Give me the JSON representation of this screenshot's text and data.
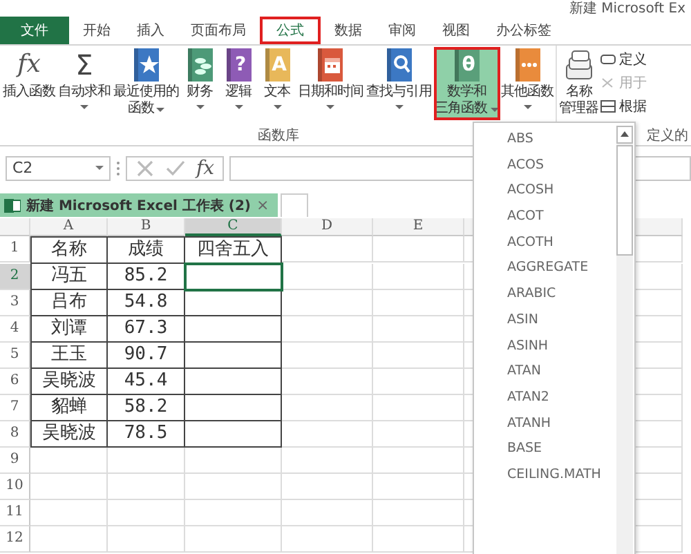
{
  "window": {
    "title": "新建 Microsoft Ex"
  },
  "tabs": [
    {
      "label": "文件",
      "kind": "file",
      "selected": false
    },
    {
      "label": "开始",
      "kind": "tab",
      "selected": false
    },
    {
      "label": "插入",
      "kind": "tab",
      "selected": false
    },
    {
      "label": "页面布局",
      "kind": "tab",
      "selected": false
    },
    {
      "label": "公式",
      "kind": "tab",
      "selected": true
    },
    {
      "label": "数据",
      "kind": "tab",
      "selected": false
    },
    {
      "label": "审阅",
      "kind": "tab",
      "selected": false
    },
    {
      "label": "视图",
      "kind": "tab",
      "selected": false
    },
    {
      "label": "办公标签",
      "kind": "tab",
      "selected": false
    }
  ],
  "ribbon": {
    "groups": [
      {
        "label": "函数库",
        "buttons": [
          {
            "lines": [
              "插入函数"
            ],
            "kind": "fx",
            "glyph": "fx",
            "dropdown": false,
            "selected": false
          },
          {
            "lines": [
              "自动求和"
            ],
            "kind": "sigma",
            "glyph": "Σ",
            "dropdown": true,
            "selected": false
          },
          {
            "lines": [
              "最近使用的",
              "函数"
            ],
            "kind": "recent",
            "dropdown": true,
            "selected": false
          },
          {
            "lines": [
              "财务"
            ],
            "kind": "finance",
            "dropdown": true,
            "selected": false
          },
          {
            "lines": [
              "逻辑"
            ],
            "kind": "logic",
            "glyph": "?",
            "dropdown": true,
            "selected": false
          },
          {
            "lines": [
              "文本"
            ],
            "kind": "text",
            "glyph": "A",
            "dropdown": true,
            "selected": false
          },
          {
            "lines": [
              "日期和时间"
            ],
            "kind": "date",
            "dropdown": true,
            "selected": false
          },
          {
            "lines": [
              "查找与引用"
            ],
            "kind": "lookup",
            "dropdown": true,
            "selected": false
          },
          {
            "lines": [
              "数学和",
              "三角函数"
            ],
            "kind": "math",
            "glyph": "θ",
            "dropdown": true,
            "selected": true
          },
          {
            "lines": [
              "其他函数"
            ],
            "kind": "other",
            "dropdown": true,
            "selected": false
          }
        ]
      },
      {
        "label": "定义的",
        "buttons": [
          {
            "lines": [
              "名称",
              "管理器"
            ],
            "kind": "names",
            "dropdown": false,
            "selected": false
          }
        ],
        "small_items": [
          {
            "label": "定义",
            "kind": "define",
            "disabled": false
          },
          {
            "label": "用于",
            "kind": "use",
            "disabled": true
          },
          {
            "label": "根据",
            "kind": "create",
            "disabled": false
          }
        ]
      }
    ]
  },
  "formula_bar": {
    "name_box": "C2",
    "cancel_enabled": false,
    "enter_enabled": false,
    "fx": "fx"
  },
  "workbook_tab": {
    "label": "新建 Microsoft Excel 工作表 (2)",
    "close": "×"
  },
  "sheet": {
    "columns": [
      {
        "label": "A",
        "selected": false
      },
      {
        "label": "B",
        "selected": false
      },
      {
        "label": "C",
        "selected": true
      },
      {
        "label": "D",
        "selected": false
      },
      {
        "label": "E",
        "selected": false
      }
    ],
    "rows": [
      {
        "number": "1",
        "selected": false,
        "bordered": true,
        "cells": {
          "A": "名称",
          "B": "成绩",
          "C": "四舍五入"
        }
      },
      {
        "number": "2",
        "selected": true,
        "bordered": true,
        "cells": {
          "A": "冯五",
          "B": "85.2"
        }
      },
      {
        "number": "3",
        "selected": false,
        "bordered": true,
        "cells": {
          "A": "吕布",
          "B": "54.8"
        }
      },
      {
        "number": "4",
        "selected": false,
        "bordered": true,
        "cells": {
          "A": "刘谭",
          "B": "67.3"
        }
      },
      {
        "number": "5",
        "selected": false,
        "bordered": true,
        "cells": {
          "A": "王玉",
          "B": "90.7"
        }
      },
      {
        "number": "6",
        "selected": false,
        "bordered": true,
        "cells": {
          "A": "吴晓波",
          "B": "45.4"
        }
      },
      {
        "number": "7",
        "selected": false,
        "bordered": true,
        "cells": {
          "A": "貂蝉",
          "B": "58.2"
        }
      },
      {
        "number": "8",
        "selected": false,
        "bordered": true,
        "cells": {
          "A": "吴晓波",
          "B": "78.5"
        }
      },
      {
        "number": "9",
        "selected": false,
        "bordered": false,
        "cells": {}
      },
      {
        "number": "10",
        "selected": false,
        "bordered": false,
        "cells": {}
      },
      {
        "number": "11",
        "selected": false,
        "bordered": false,
        "cells": {}
      },
      {
        "number": "12",
        "selected": false,
        "bordered": false,
        "cells": {}
      }
    ]
  },
  "function_menu": {
    "items": [
      "ABS",
      "ACOS",
      "ACOSH",
      "ACOT",
      "ACOTH",
      "AGGREGATE",
      "ARABIC",
      "ASIN",
      "ASINH",
      "ATAN",
      "ATAN2",
      "ATANH",
      "BASE",
      "CEILING.MATH"
    ]
  }
}
